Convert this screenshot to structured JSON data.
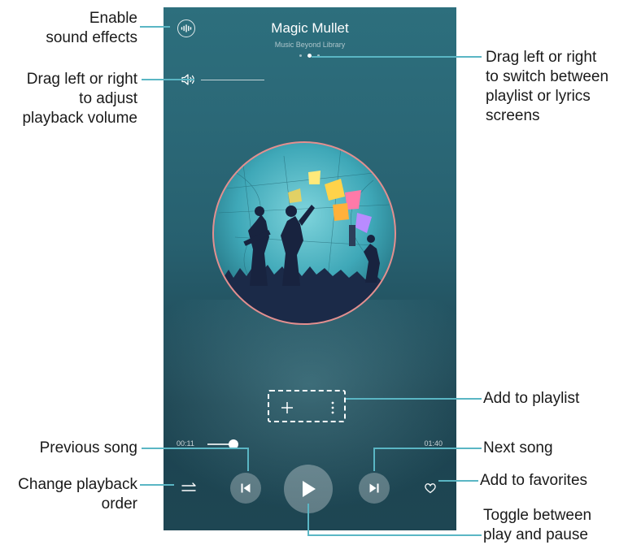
{
  "player": {
    "title": "Magic Mullet",
    "artist": "Music Beyond Library",
    "page_count": 3,
    "active_page": 1,
    "elapsed": "00:11",
    "duration": "01:40",
    "progress_fraction": 0.11
  },
  "icons": {
    "sound_effects": "sound-effects-icon",
    "volume": "volume-icon",
    "add": "plus-icon",
    "more": "more-vertical-icon",
    "order": "shuffle-order-icon",
    "previous": "previous-icon",
    "play": "play-icon",
    "next": "next-icon",
    "favorite": "heart-icon"
  },
  "colors": {
    "screen_top": "#2d6f7d",
    "screen_bottom": "#1e4653",
    "accent": "#5ab6c4",
    "leader": "#5ab6c4"
  },
  "callouts": {
    "sound_effects": [
      "Enable",
      "sound effects"
    ],
    "volume": [
      "Drag left or right",
      "to adjust",
      "playback volume"
    ],
    "switch_screens": [
      "Drag left or right",
      "to switch between",
      "playlist or lyrics",
      "screens"
    ],
    "add_playlist": [
      "Add to playlist"
    ],
    "previous": [
      "Previous song"
    ],
    "next": [
      "Next song"
    ],
    "order": [
      "Change playback",
      "order"
    ],
    "favorites": [
      "Add to favorites"
    ],
    "play_pause": [
      "Toggle between",
      "play and pause"
    ]
  }
}
